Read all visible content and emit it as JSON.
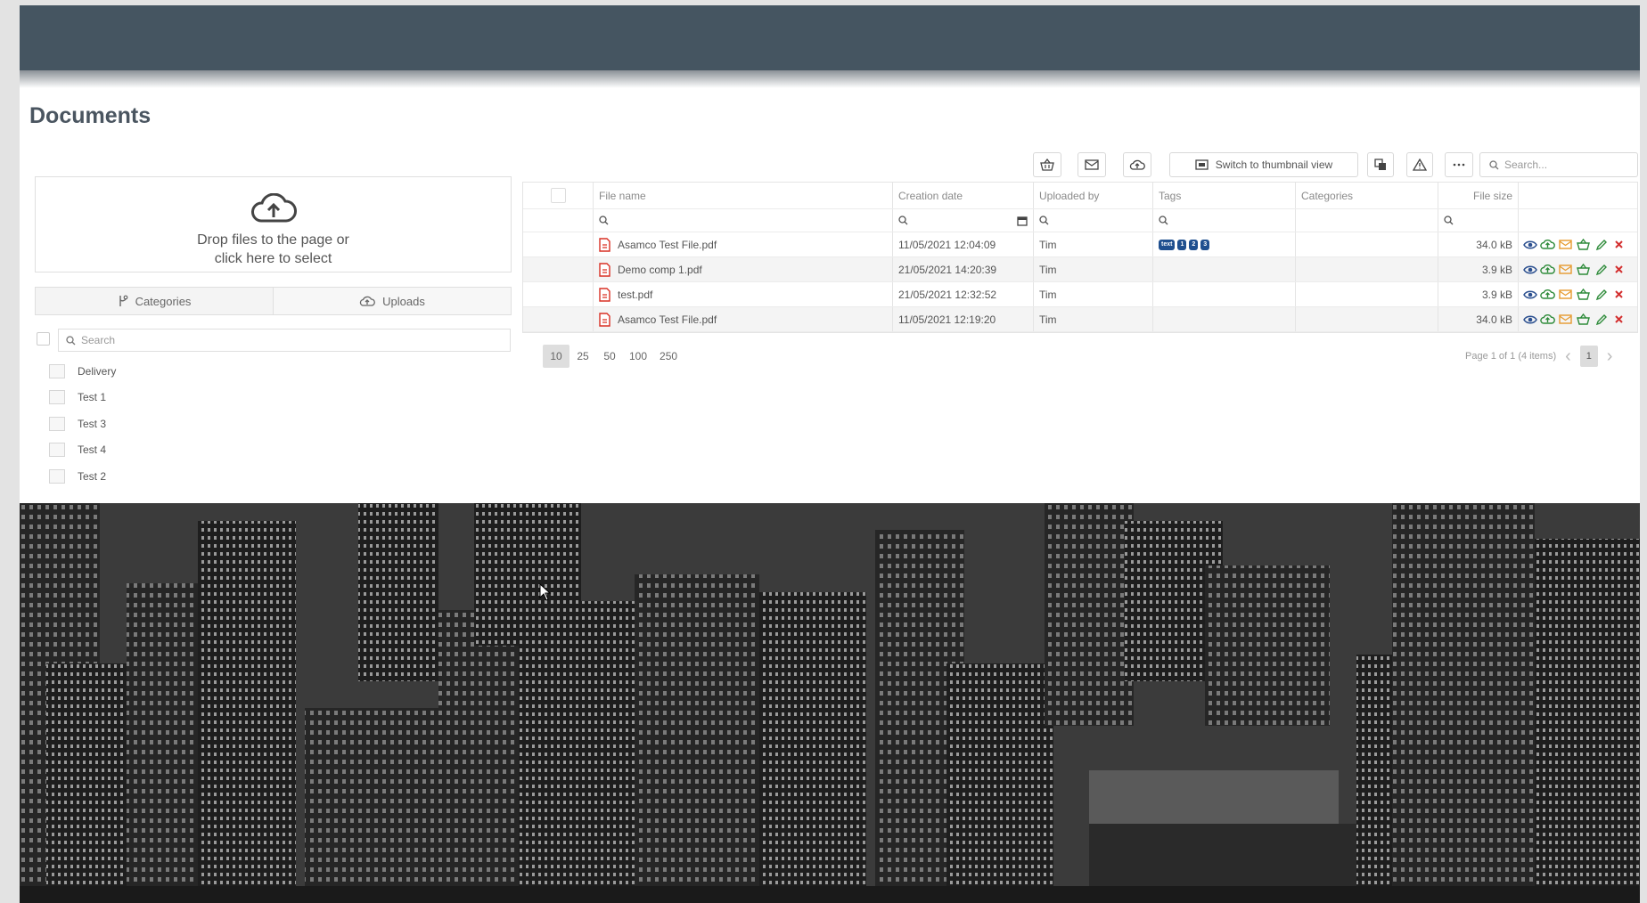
{
  "page": {
    "title": "Documents"
  },
  "dropzone": {
    "line1": "Drop files to the page or",
    "line2": "click here to select",
    "icon": "cloud-upload-icon"
  },
  "left_tabs": [
    {
      "label": "Categories",
      "icon": "branch-icon"
    },
    {
      "label": "Uploads",
      "icon": "cloud-upload-icon"
    }
  ],
  "categories": {
    "search_placeholder": "Search",
    "items": [
      "Delivery",
      "Test 1",
      "Test 3",
      "Test 4",
      "Test 2"
    ]
  },
  "toolbar": {
    "thumbnail_label": "Switch to thumbnail view",
    "search_placeholder": "Search...",
    "icons": [
      "basket-icon",
      "mail-icon",
      "cloud-upload-icon",
      "image-icon",
      "copy-icon",
      "warning-icon",
      "more-icon"
    ]
  },
  "grid": {
    "columns": [
      "File name",
      "Creation date",
      "Uploaded by",
      "Tags",
      "Categories",
      "File size"
    ],
    "rows": [
      {
        "name": "Asamco Test File.pdf",
        "date": "11/05/2021 12:04:09",
        "uploader": "Tim",
        "tags": [
          "text",
          "1",
          "2",
          "3"
        ],
        "categories": "",
        "size": "34.0 kB"
      },
      {
        "name": "Demo comp 1.pdf",
        "date": "21/05/2021 14:20:39",
        "uploader": "Tim",
        "tags": [],
        "categories": "",
        "size": "3.9 kB"
      },
      {
        "name": "test.pdf",
        "date": "21/05/2021 12:32:52",
        "uploader": "Tim",
        "tags": [],
        "categories": "",
        "size": "3.9 kB"
      },
      {
        "name": "Asamco Test File.pdf",
        "date": "11/05/2021 12:19:20",
        "uploader": "Tim",
        "tags": [],
        "categories": "",
        "size": "34.0 kB"
      }
    ],
    "row_actions": [
      "eye-icon",
      "cloud-upload-icon",
      "mail-icon",
      "basket-icon",
      "pencil-icon",
      "delete-icon"
    ]
  },
  "pager": {
    "sizes": [
      "10",
      "25",
      "50",
      "100",
      "250"
    ],
    "active_size": "10",
    "info": "Page 1 of 1 (4 items)",
    "current_page": "1"
  },
  "colors": {
    "topbar": "#455561",
    "tag_bg": "#1f4f8f",
    "pdf_red": "#d93025",
    "delete_red": "#d32f2f",
    "action_green": "#2e8b3a",
    "action_orange": "#e69a2e",
    "eye_blue": "#2b4f8f"
  }
}
